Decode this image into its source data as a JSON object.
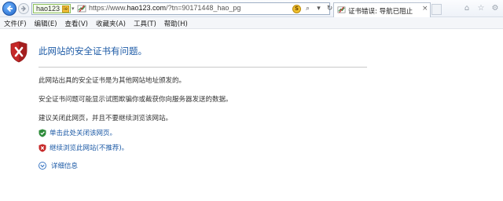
{
  "address_bar": {
    "site_chip": "hao123",
    "url_prefix": "https://www.",
    "url_domain": "hao123.com",
    "url_rest": "/?tn=90171448_hao_pg"
  },
  "tab": {
    "label": "证书错误: 导航已阻止"
  },
  "menu": [
    "文件(F)",
    "编辑(E)",
    "查看(V)",
    "收藏夹(A)",
    "工具(T)",
    "帮助(H)"
  ],
  "page": {
    "title": "此网站的安全证书有问题。",
    "para1": "此网站出具的安全证书是为其他网站地址颁发的。",
    "para2": "安全证书问题可能显示试图欺骗你或截获你向服务器发送的数据。",
    "para3": "建议关闭此网页，并且不要继续浏览该网站。",
    "option_close": "单击此处关闭该网页。",
    "option_continue": "继续浏览此网站(不推荐)。",
    "more_info": "详细信息"
  },
  "icons": {
    "back": "back-arrow-icon",
    "forward": "forward-arrow-icon",
    "certificate_error": "certificate-error-icon",
    "compatibility": "compatibility-view-icon",
    "search": "search-icon",
    "refresh": "refresh-icon",
    "stop": "stop-icon",
    "shield": "shield-error-icon"
  },
  "colors": {
    "link": "#1c5aa6",
    "title": "#1c5aa6",
    "shield_red": "#c62828",
    "safe_green": "#2e8b3a"
  }
}
